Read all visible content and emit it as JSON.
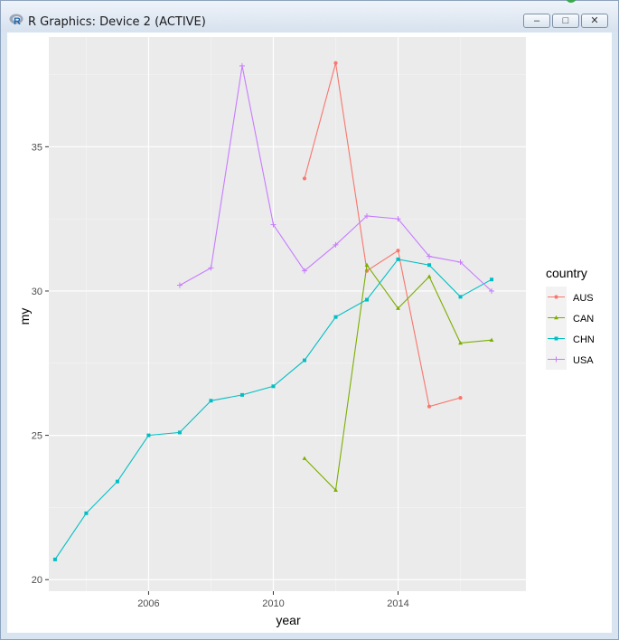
{
  "window": {
    "title": "R Graphics: Device 2 (ACTIVE)",
    "buttons": {
      "minimize": "–",
      "maximize": "□",
      "close": "✕"
    }
  },
  "chart_data": {
    "type": "line",
    "title": "",
    "xlabel": "year",
    "ylabel": "my",
    "xlim": [
      2002.8,
      2018.1
    ],
    "ylim": [
      19.6,
      38.8
    ],
    "xticks": [
      2006,
      2010,
      2014
    ],
    "yticks": [
      20,
      25,
      30,
      35
    ],
    "grid": true,
    "legend": {
      "title": "country",
      "position": "right"
    },
    "series": [
      {
        "name": "AUS",
        "color": "#F8766D",
        "marker": "circle",
        "points": [
          [
            2011,
            33.9
          ],
          [
            2012,
            37.9
          ],
          [
            2013,
            30.7
          ],
          [
            2014,
            31.4
          ],
          [
            2015,
            26.0
          ],
          [
            2016,
            26.3
          ]
        ]
      },
      {
        "name": "CAN",
        "color": "#7CAE00",
        "marker": "triangle",
        "points": [
          [
            2011,
            24.2
          ],
          [
            2012,
            23.1
          ],
          [
            2013,
            30.9
          ],
          [
            2014,
            29.4
          ],
          [
            2015,
            30.5
          ],
          [
            2016,
            28.2
          ],
          [
            2017,
            28.3
          ]
        ]
      },
      {
        "name": "CHN",
        "color": "#00BFC4",
        "marker": "square",
        "points": [
          [
            2003,
            20.7
          ],
          [
            2004,
            22.3
          ],
          [
            2005,
            23.4
          ],
          [
            2006,
            25.0
          ],
          [
            2007,
            25.1
          ],
          [
            2008,
            26.2
          ],
          [
            2009,
            26.4
          ],
          [
            2010,
            26.7
          ],
          [
            2011,
            27.6
          ],
          [
            2012,
            29.1
          ],
          [
            2013,
            29.7
          ],
          [
            2014,
            31.1
          ],
          [
            2015,
            30.9
          ],
          [
            2016,
            29.8
          ],
          [
            2017,
            30.4
          ]
        ]
      },
      {
        "name": "USA",
        "color": "#C77CFF",
        "marker": "cross",
        "points": [
          [
            2007,
            30.2
          ],
          [
            2008,
            30.8
          ],
          [
            2009,
            37.8
          ],
          [
            2010,
            32.3
          ],
          [
            2011,
            30.7
          ],
          [
            2012,
            31.6
          ],
          [
            2013,
            32.6
          ],
          [
            2014,
            32.5
          ],
          [
            2015,
            31.2
          ],
          [
            2016,
            31.0
          ],
          [
            2017,
            30.0
          ]
        ]
      }
    ]
  }
}
